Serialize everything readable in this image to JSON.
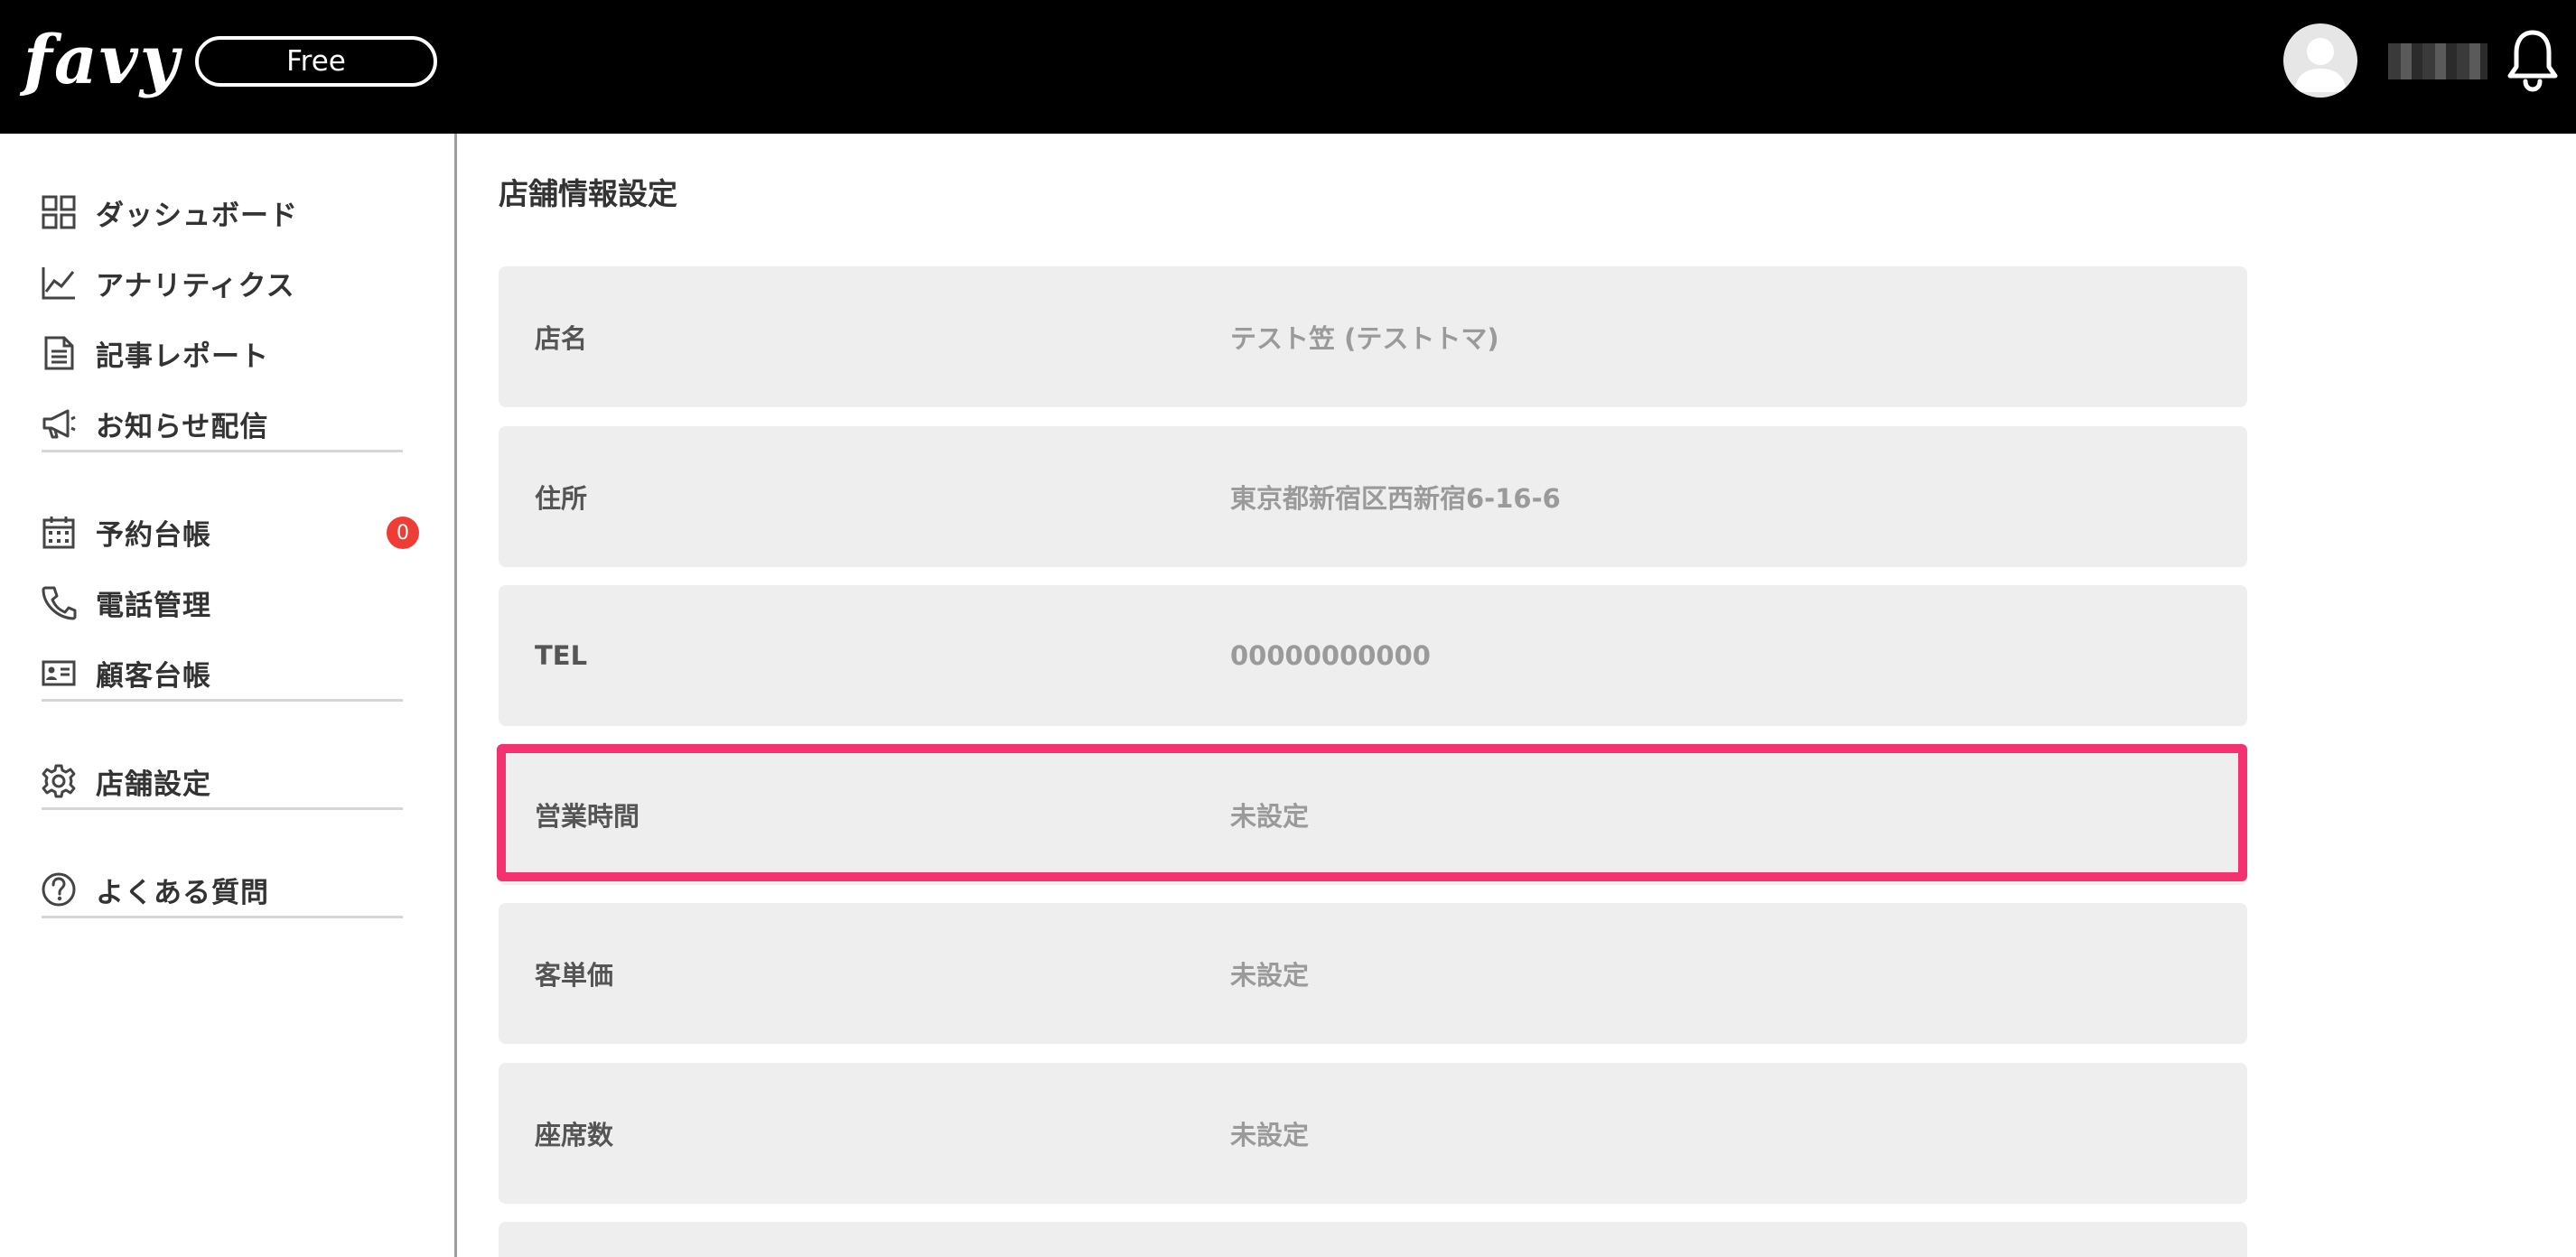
{
  "header": {
    "logo_text": "favy",
    "plan_label": "Free",
    "user_name": "████"
  },
  "sidebar": {
    "groups": [
      [
        {
          "label": "ダッシュボード",
          "icon": "dashboard-grid-icon"
        },
        {
          "label": "アナリティクス",
          "icon": "analytics-chart-icon"
        },
        {
          "label": "記事レポート",
          "icon": "document-icon"
        },
        {
          "label": "お知らせ配信",
          "icon": "megaphone-icon"
        }
      ],
      [
        {
          "label": "予約台帳",
          "icon": "calendar-icon",
          "badge": "0"
        },
        {
          "label": "電話管理",
          "icon": "phone-icon"
        },
        {
          "label": "顧客台帳",
          "icon": "id-card-icon"
        }
      ],
      [
        {
          "label": "店舗設定",
          "icon": "gear-icon"
        }
      ],
      [
        {
          "label": "よくある質問",
          "icon": "help-circle-icon"
        }
      ]
    ]
  },
  "main": {
    "title": "店舗情報設定",
    "rows": [
      {
        "label": "店名",
        "value": "テスト笠 (テストトマ)"
      },
      {
        "label": "住所",
        "value": "東京都新宿区西新宿6-16-6"
      },
      {
        "label": "TEL",
        "value": "00000000000"
      },
      {
        "label": "営業時間",
        "value": "未設定"
      },
      {
        "label": "客単価",
        "value": "未設定"
      },
      {
        "label": "座席数",
        "value": "未設定"
      },
      {
        "label": "",
        "value": ""
      }
    ],
    "highlighted_row": "営業時間"
  },
  "colors": {
    "header_bg": "#000000",
    "highlight": "#f3326f",
    "badge": "#ef3d36",
    "row_bg": "#eeeeee"
  }
}
